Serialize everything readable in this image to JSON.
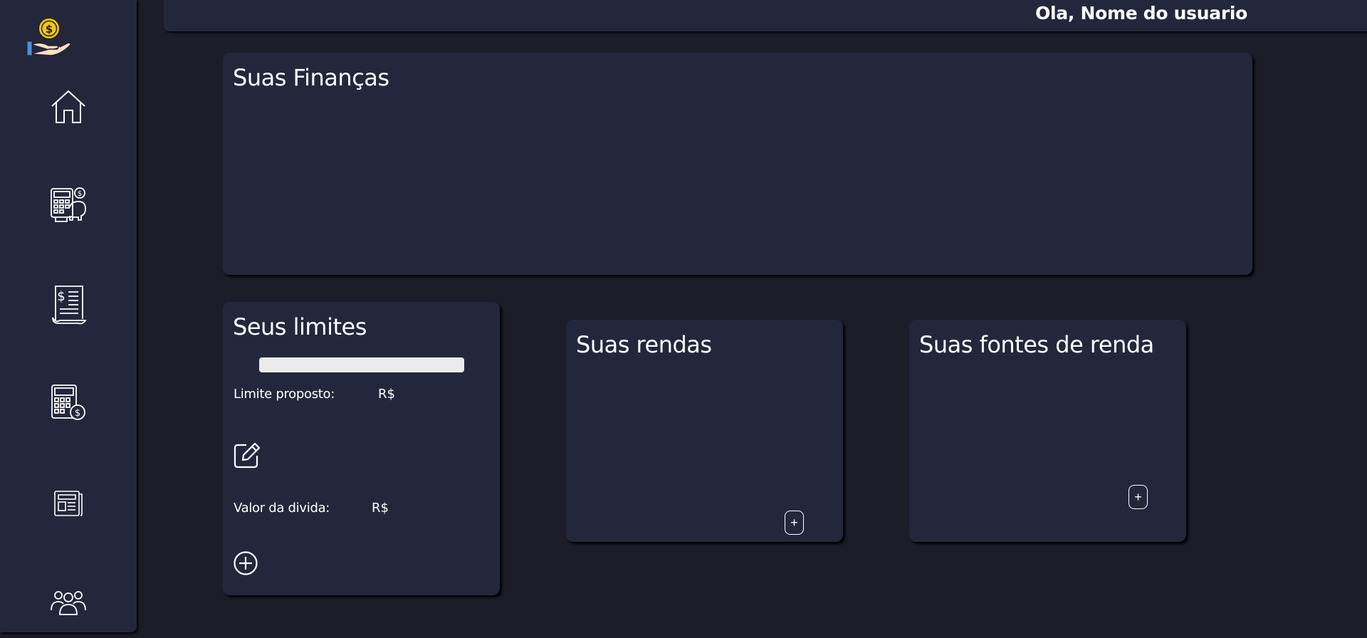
{
  "header": {
    "greeting": "Ola, Nome do usuario"
  },
  "sidebar": {
    "logo_icon": "coin-hand-icon",
    "items": [
      {
        "name": "home",
        "icon": "home-icon"
      },
      {
        "name": "calculator-savings",
        "icon": "calculator-piggy-bank-icon"
      },
      {
        "name": "invoice",
        "icon": "invoice-icon"
      },
      {
        "name": "budget-calculator",
        "icon": "calculator-dollar-icon"
      },
      {
        "name": "news",
        "icon": "newspaper-icon"
      },
      {
        "name": "community",
        "icon": "users-group-icon"
      }
    ]
  },
  "finances": {
    "title": "Suas Finanças"
  },
  "limits": {
    "title": "Seus limites",
    "progress": 1.0,
    "proposed_label": "Limite proposto:",
    "proposed_value": "R$",
    "edit_icon": "edit-icon",
    "debt_label": "Valor da divida:",
    "debt_value": "R$",
    "add_icon": "add-circle-icon"
  },
  "incomes": {
    "title": "Suas rendas",
    "add_label": "+"
  },
  "sources": {
    "title": "Suas fontes de renda",
    "add_label": "+"
  },
  "colors": {
    "background": "#1c1d29",
    "panel": "#24273c",
    "text": "#ffffff",
    "progress": "#ebebeb",
    "coin": "#f5c518"
  }
}
